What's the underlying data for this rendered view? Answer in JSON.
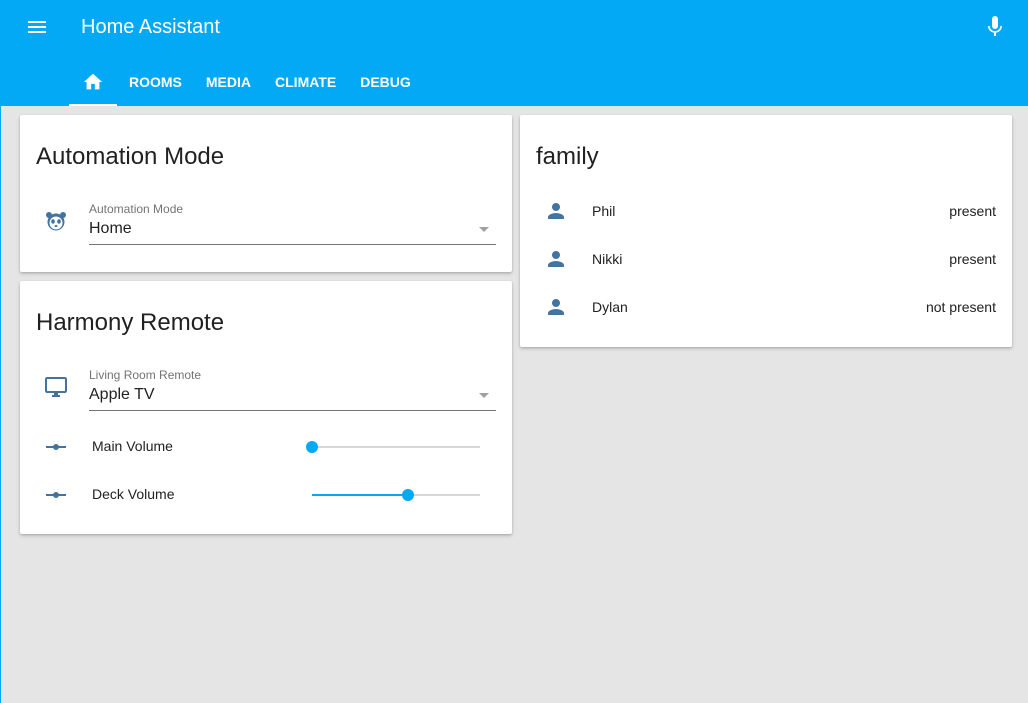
{
  "header": {
    "title": "Home Assistant",
    "tabs": [
      {
        "label": "",
        "icon": "home-icon"
      },
      {
        "label": "ROOMS"
      },
      {
        "label": "MEDIA"
      },
      {
        "label": "CLIMATE"
      },
      {
        "label": "DEBUG"
      }
    ],
    "active_tab": 0
  },
  "automation_card": {
    "title": "Automation Mode",
    "icon": "panda-icon",
    "select": {
      "label": "Automation Mode",
      "value": "Home"
    }
  },
  "harmony_card": {
    "title": "Harmony Remote",
    "icon": "monitor-icon",
    "select": {
      "label": "Living Room Remote",
      "value": "Apple TV"
    },
    "sliders": [
      {
        "label": "Main Volume",
        "value": 0,
        "icon": "slider-icon"
      },
      {
        "label": "Deck Volume",
        "value": 0.57,
        "icon": "slider-icon"
      }
    ]
  },
  "family_card": {
    "title": "family",
    "members": [
      {
        "name": "Phil",
        "state": "present",
        "icon": "person-icon"
      },
      {
        "name": "Nikki",
        "state": "present",
        "icon": "person-icon"
      },
      {
        "name": "Dylan",
        "state": "not present",
        "icon": "person-icon"
      }
    ]
  },
  "colors": {
    "primary": "#03a9f4",
    "icon": "#44739e",
    "background": "#e5e5e5"
  }
}
